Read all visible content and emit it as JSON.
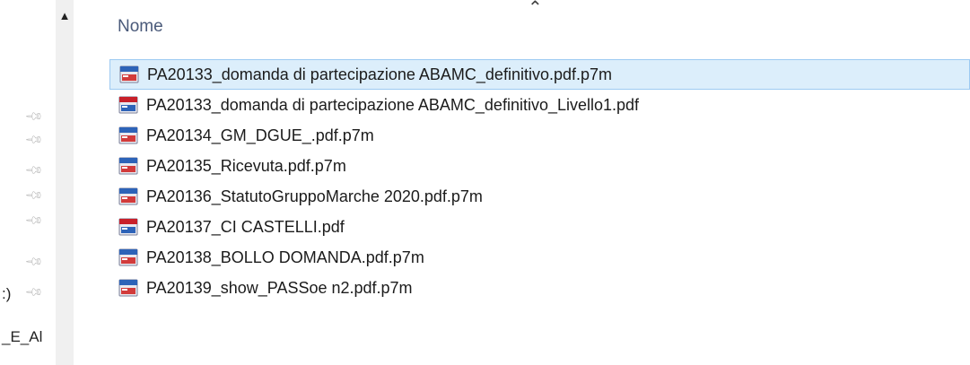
{
  "header": {
    "column_name": "Nome"
  },
  "nav": {
    "partial_labels": [
      ":)",
      "_E_Al"
    ]
  },
  "files": [
    {
      "name": "PA20133_domanda di partecipazione ABAMC_definitivo.pdf.p7m",
      "icon": "p7m-file-icon",
      "selected": true
    },
    {
      "name": "PA20133_domanda di partecipazione ABAMC_definitivo_Livello1.pdf",
      "icon": "pdf-file-icon",
      "selected": false
    },
    {
      "name": "PA20134_GM_DGUE_.pdf.p7m",
      "icon": "p7m-file-icon",
      "selected": false
    },
    {
      "name": "PA20135_Ricevuta.pdf.p7m",
      "icon": "p7m-file-icon",
      "selected": false
    },
    {
      "name": "PA20136_StatutoGruppoMarche 2020.pdf.p7m",
      "icon": "p7m-file-icon",
      "selected": false
    },
    {
      "name": "PA20137_CI CASTELLI.pdf",
      "icon": "pdf-file-icon",
      "selected": false
    },
    {
      "name": "PA20138_BOLLO DOMANDA.pdf.p7m",
      "icon": "p7m-file-icon",
      "selected": false
    },
    {
      "name": "PA20139_show_PASSoe n2.pdf.p7m",
      "icon": "p7m-file-icon",
      "selected": false
    }
  ],
  "colors": {
    "selection_bg": "#dceefb",
    "selection_border": "#9dcaf2",
    "header_text": "#4a5a7a"
  }
}
